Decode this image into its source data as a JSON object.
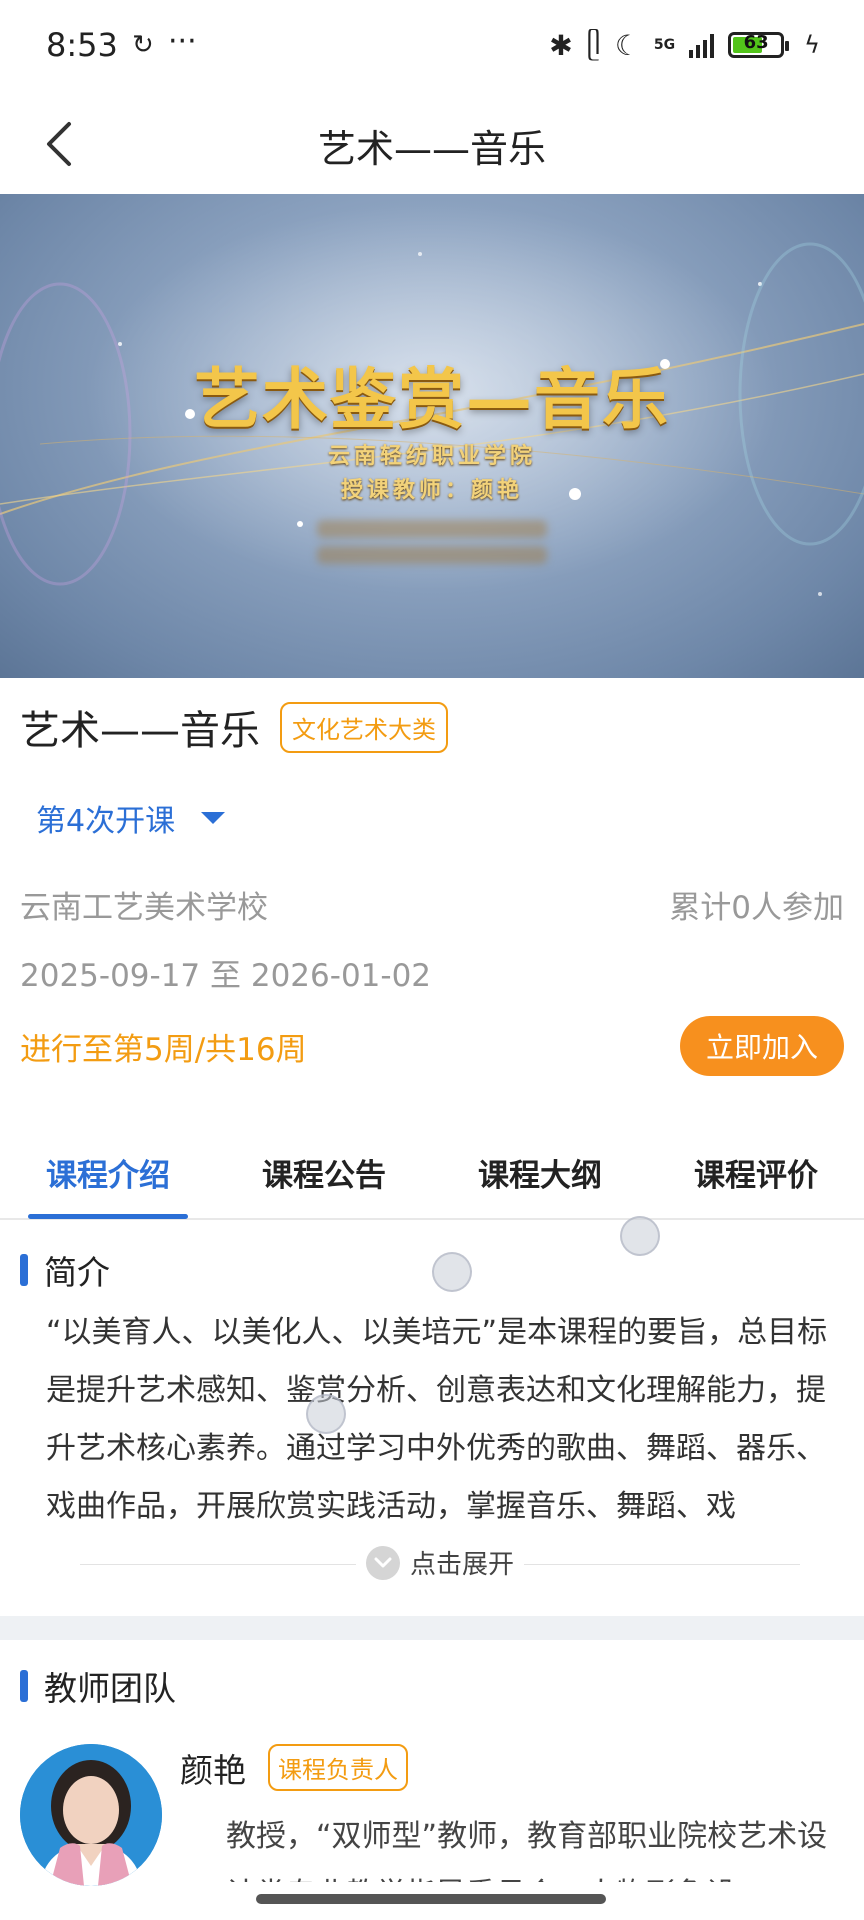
{
  "status_bar": {
    "time": "8:53",
    "dots": "···",
    "battery": "63",
    "network": "5G"
  },
  "nav": {
    "title": "艺术——音乐"
  },
  "banner": {
    "title": "艺术鉴赏—音乐",
    "line1": "云南轻纺职业学院",
    "line2": "授课教师：颜艳"
  },
  "course": {
    "title": "艺术——音乐",
    "category": "文化艺术大类",
    "session": "第4次开课",
    "school": "云南工艺美术学校",
    "participants": "累计0人参加",
    "dates": "2025-09-17 至 2026-01-02",
    "progress": "进行至第5周/共16周",
    "join_label": "立即加入"
  },
  "tabs": [
    {
      "label": "课程介绍",
      "active": true
    },
    {
      "label": "课程公告",
      "active": false
    },
    {
      "label": "课程大纲",
      "active": false
    },
    {
      "label": "课程评价",
      "active": false
    }
  ],
  "intro": {
    "heading": "简介",
    "text": "“以美育人、以美化人、以美培元”是本课程的要旨，总目标是提升艺术感知、鉴赏分析、创意表达和文化理解能力，提升艺术核心素养。通过学习中外优秀的歌曲、舞蹈、器乐、戏曲作品，开展欣赏实践活动，掌握音乐、舞蹈、戏",
    "expand_label": "点击展开"
  },
  "teachers": {
    "heading": "教师团队",
    "items": [
      {
        "name": "颜艳",
        "role": "课程负责人",
        "bio": "教授，“双师型”教师，教育部职业院校艺术设计类专业教学指导委员会，人物形象设"
      }
    ]
  },
  "colors": {
    "accent_blue": "#2b6fd6",
    "accent_orange": "#f39c12",
    "join_button": "#f7901e"
  }
}
